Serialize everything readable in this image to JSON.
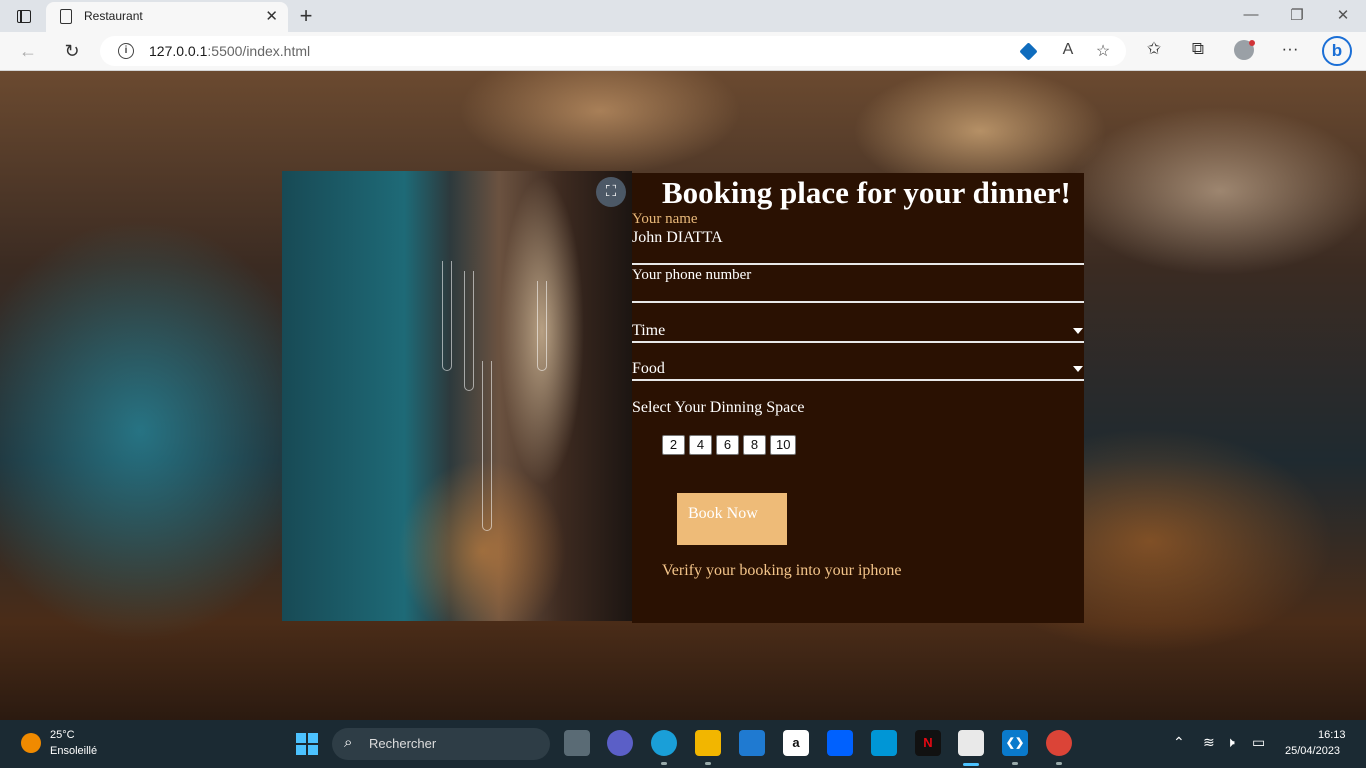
{
  "browser": {
    "tab_title": "Restaurant",
    "url_host": "127.0.0.1",
    "url_path": ":5500/index.html",
    "icons": {
      "sidebar": "tab-actions-icon",
      "page": "page-icon",
      "close": "close-icon",
      "new_tab": "plus-icon",
      "back": "arrow-left-icon",
      "reload": "reload-icon",
      "info": "info-icon",
      "tag": "tag-icon",
      "read_aloud": "read-aloud-icon",
      "favorite": "star-add-icon",
      "favorites": "favorites-icon",
      "collections": "collections-icon",
      "profile": "profile-icon",
      "more": "more-icon",
      "bing": "bing-icon"
    },
    "glyphs": {
      "close": "✕",
      "new_tab": "+",
      "minimize": "—",
      "restore": "❐",
      "window_close": "✕",
      "back": "←",
      "reload": "↻",
      "info": "i",
      "read_aloud": "A",
      "favorite": "☆",
      "favorites": "✩",
      "collections": "⧉",
      "more": "···",
      "bing": "b"
    }
  },
  "page": {
    "heading": "Booking place for your dinner!",
    "name_label": "Your name",
    "name_value": "John DIATTA",
    "phone_label": "Your phone number",
    "time_label": "Time",
    "food_label": "Food",
    "space_label": "Select Your Dinning Space",
    "space_options": [
      "2",
      "4",
      "6",
      "8",
      "10"
    ],
    "book_button": "Book Now",
    "verify_text": "Verify your booking into your iphone",
    "colors": {
      "panel_bg": "#2a1102",
      "button_bg": "#eebb78",
      "name_label": "#e9b97a",
      "verify_text": "#f4c58a"
    }
  },
  "taskbar": {
    "weather_temp": "25°C",
    "weather_condition": "Ensoleillé",
    "search_placeholder": "Rechercher",
    "time": "16:13",
    "date": "25/04/2023",
    "apps": [
      "task-view",
      "teams",
      "edge",
      "file-explorer",
      "mail",
      "amazon",
      "dropbox",
      "myhp",
      "netflix",
      "snipping-tool",
      "vscode",
      "chrome"
    ],
    "glyphs": {
      "search": "⌕",
      "amazon": "a",
      "netflix": "N",
      "vscode": "❮❯",
      "chevron": "⌃",
      "wifi": "≋",
      "volume": "🕨",
      "battery": "▭"
    }
  }
}
